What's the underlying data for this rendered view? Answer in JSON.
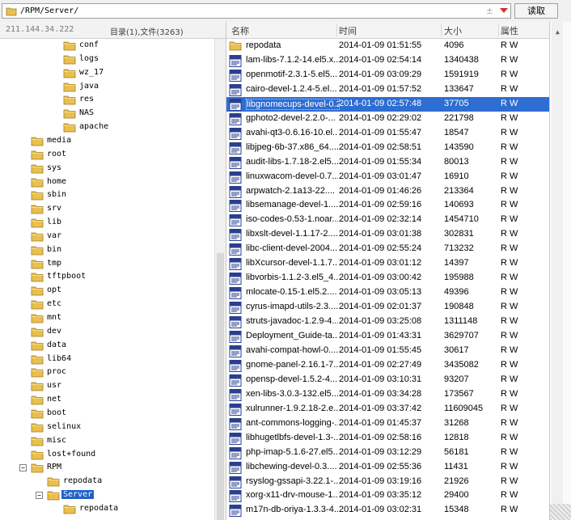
{
  "address": {
    "path": "/RPM/Server/",
    "star": "±",
    "read_label": "读取"
  },
  "left": {
    "ip": "211.144.34.222",
    "summary": "目录(1),文件(3263)",
    "tree": [
      {
        "label": "conf",
        "indent": 3,
        "expander": ""
      },
      {
        "label": "logs",
        "indent": 3,
        "expander": ""
      },
      {
        "label": "wz_17",
        "indent": 3,
        "expander": ""
      },
      {
        "label": "java",
        "indent": 3,
        "expander": ""
      },
      {
        "label": "res",
        "indent": 3,
        "expander": ""
      },
      {
        "label": "NAS",
        "indent": 3,
        "expander": ""
      },
      {
        "label": "apache",
        "indent": 3,
        "expander": ""
      },
      {
        "label": "media",
        "indent": 1,
        "expander": ""
      },
      {
        "label": "root",
        "indent": 1,
        "expander": ""
      },
      {
        "label": "sys",
        "indent": 1,
        "expander": ""
      },
      {
        "label": "home",
        "indent": 1,
        "expander": ""
      },
      {
        "label": "sbin",
        "indent": 1,
        "expander": ""
      },
      {
        "label": "srv",
        "indent": 1,
        "expander": ""
      },
      {
        "label": "lib",
        "indent": 1,
        "expander": ""
      },
      {
        "label": "var",
        "indent": 1,
        "expander": ""
      },
      {
        "label": "bin",
        "indent": 1,
        "expander": ""
      },
      {
        "label": "tmp",
        "indent": 1,
        "expander": ""
      },
      {
        "label": "tftpboot",
        "indent": 1,
        "expander": ""
      },
      {
        "label": "opt",
        "indent": 1,
        "expander": ""
      },
      {
        "label": "etc",
        "indent": 1,
        "expander": ""
      },
      {
        "label": "mnt",
        "indent": 1,
        "expander": ""
      },
      {
        "label": "dev",
        "indent": 1,
        "expander": ""
      },
      {
        "label": "data",
        "indent": 1,
        "expander": ""
      },
      {
        "label": "lib64",
        "indent": 1,
        "expander": ""
      },
      {
        "label": "proc",
        "indent": 1,
        "expander": ""
      },
      {
        "label": "usr",
        "indent": 1,
        "expander": ""
      },
      {
        "label": "net",
        "indent": 1,
        "expander": ""
      },
      {
        "label": "boot",
        "indent": 1,
        "expander": ""
      },
      {
        "label": "selinux",
        "indent": 1,
        "expander": ""
      },
      {
        "label": "misc",
        "indent": 1,
        "expander": ""
      },
      {
        "label": "lost+found",
        "indent": 1,
        "expander": ""
      },
      {
        "label": "RPM",
        "indent": 1,
        "expander": "−"
      },
      {
        "label": "repodata",
        "indent": 2,
        "expander": ""
      },
      {
        "label": "Server",
        "indent": 2,
        "expander": "−",
        "selected": true
      },
      {
        "label": "repodata",
        "indent": 3,
        "expander": ""
      }
    ]
  },
  "columns": {
    "name": "名称",
    "time": "时间",
    "size": "大小",
    "attr": "属性"
  },
  "files": [
    {
      "icon": "folder",
      "name": "repodata",
      "time": "2014-01-09 01:51:55",
      "size": "4096",
      "attr": "R W"
    },
    {
      "icon": "file",
      "name": "lam-libs-7.1.2-14.el5.x...",
      "time": "2014-01-09 02:54:14",
      "size": "1340438",
      "attr": "R W"
    },
    {
      "icon": "file",
      "name": "openmotif-2.3.1-5.el5...",
      "time": "2014-01-09 03:09:29",
      "size": "1591919",
      "attr": "R W"
    },
    {
      "icon": "file",
      "name": "cairo-devel-1.2.4-5.el...",
      "time": "2014-01-09 01:57:52",
      "size": "133647",
      "attr": "R W"
    },
    {
      "icon": "file",
      "name": "libgnomecups-devel-0.2...",
      "time": "2014-01-09 02:57:48",
      "size": "37705",
      "attr": "R W",
      "selected": true
    },
    {
      "icon": "file",
      "name": "gphoto2-devel-2.2.0-...",
      "time": "2014-01-09 02:29:02",
      "size": "221798",
      "attr": "R W"
    },
    {
      "icon": "file",
      "name": "avahi-qt3-0.6.16-10.el...",
      "time": "2014-01-09 01:55:47",
      "size": "18547",
      "attr": "R W"
    },
    {
      "icon": "file",
      "name": "libjpeg-6b-37.x86_64....",
      "time": "2014-01-09 02:58:51",
      "size": "143590",
      "attr": "R W"
    },
    {
      "icon": "file",
      "name": "audit-libs-1.7.18-2.el5...",
      "time": "2014-01-09 01:55:34",
      "size": "80013",
      "attr": "R W"
    },
    {
      "icon": "file",
      "name": "linuxwacom-devel-0.7...",
      "time": "2014-01-09 03:01:47",
      "size": "16910",
      "attr": "R W"
    },
    {
      "icon": "file",
      "name": "arpwatch-2.1a13-22....",
      "time": "2014-01-09 01:46:26",
      "size": "213364",
      "attr": "R W"
    },
    {
      "icon": "file",
      "name": "libsemanage-devel-1....",
      "time": "2014-01-09 02:59:16",
      "size": "140693",
      "attr": "R W"
    },
    {
      "icon": "file",
      "name": "iso-codes-0.53-1.noar...",
      "time": "2014-01-09 02:32:14",
      "size": "1454710",
      "attr": "R W"
    },
    {
      "icon": "file",
      "name": "libxslt-devel-1.1.17-2....",
      "time": "2014-01-09 03:01:38",
      "size": "302831",
      "attr": "R W"
    },
    {
      "icon": "file",
      "name": "libc-client-devel-2004...",
      "time": "2014-01-09 02:55:24",
      "size": "713232",
      "attr": "R W"
    },
    {
      "icon": "file",
      "name": "libXcursor-devel-1.1.7...",
      "time": "2014-01-09 03:01:12",
      "size": "14397",
      "attr": "R W"
    },
    {
      "icon": "file",
      "name": "libvorbis-1.1.2-3.el5_4...",
      "time": "2014-01-09 03:00:42",
      "size": "195988",
      "attr": "R W"
    },
    {
      "icon": "file",
      "name": "mlocate-0.15-1.el5.2....",
      "time": "2014-01-09 03:05:13",
      "size": "49396",
      "attr": "R W"
    },
    {
      "icon": "file",
      "name": "cyrus-imapd-utils-2.3....",
      "time": "2014-01-09 02:01:37",
      "size": "190848",
      "attr": "R W"
    },
    {
      "icon": "file",
      "name": "struts-javadoc-1.2.9-4...",
      "time": "2014-01-09 03:25:08",
      "size": "1311148",
      "attr": "R W"
    },
    {
      "icon": "file",
      "name": "Deployment_Guide-ta...",
      "time": "2014-01-09 01:43:31",
      "size": "3629707",
      "attr": "R W"
    },
    {
      "icon": "file",
      "name": "avahi-compat-howl-0....",
      "time": "2014-01-09 01:55:45",
      "size": "30617",
      "attr": "R W"
    },
    {
      "icon": "file",
      "name": "gnome-panel-2.16.1-7...",
      "time": "2014-01-09 02:27:49",
      "size": "3435082",
      "attr": "R W"
    },
    {
      "icon": "file",
      "name": "opensp-devel-1.5.2-4....",
      "time": "2014-01-09 03:10:31",
      "size": "93207",
      "attr": "R W"
    },
    {
      "icon": "file",
      "name": "xen-libs-3.0.3-132.el5....",
      "time": "2014-01-09 03:34:28",
      "size": "173567",
      "attr": "R W"
    },
    {
      "icon": "file",
      "name": "xulrunner-1.9.2.18-2.e...",
      "time": "2014-01-09 03:37:42",
      "size": "11609045",
      "attr": "R W"
    },
    {
      "icon": "file",
      "name": "ant-commons-logging-...",
      "time": "2014-01-09 01:45:37",
      "size": "31268",
      "attr": "R W"
    },
    {
      "icon": "file",
      "name": "libhugetlbfs-devel-1.3-...",
      "time": "2014-01-09 02:58:16",
      "size": "12818",
      "attr": "R W"
    },
    {
      "icon": "file",
      "name": "php-imap-5.1.6-27.el5...",
      "time": "2014-01-09 03:12:29",
      "size": "56181",
      "attr": "R W"
    },
    {
      "icon": "file",
      "name": "libchewing-devel-0.3....",
      "time": "2014-01-09 02:55:36",
      "size": "11431",
      "attr": "R W"
    },
    {
      "icon": "file",
      "name": "rsyslog-gssapi-3.22.1-...",
      "time": "2014-01-09 03:19:16",
      "size": "21926",
      "attr": "R W"
    },
    {
      "icon": "file",
      "name": "xorg-x11-drv-mouse-1....",
      "time": "2014-01-09 03:35:12",
      "size": "29400",
      "attr": "R W"
    },
    {
      "icon": "file",
      "name": "m17n-db-oriya-1.3.3-4...",
      "time": "2014-01-09 03:02:31",
      "size": "15348",
      "attr": "R W"
    }
  ],
  "far_right": {
    "text": ""
  },
  "colors": {
    "selection": "#2e6dd2",
    "folder": "#e8c050"
  }
}
